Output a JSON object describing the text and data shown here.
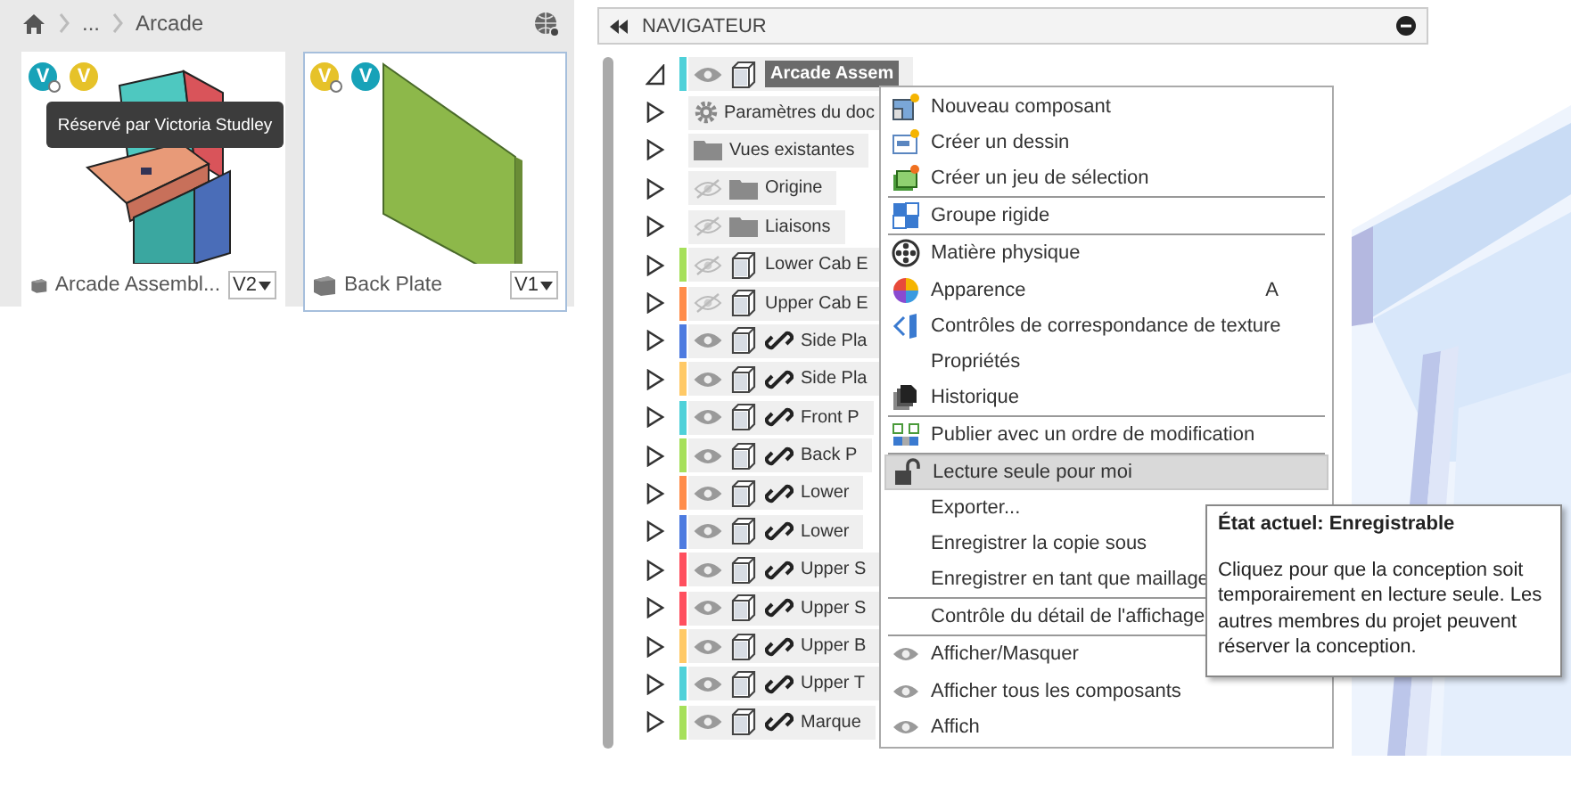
{
  "breadcrumb": [
    "...",
    "Arcade"
  ],
  "cards": [
    {
      "name": "Arcade Assembl...",
      "version": "V2",
      "selected": false,
      "tooltip": "Réservé par Victoria Studley",
      "badges": [
        {
          "letter": "V",
          "color": "#17a2b8",
          "dot": true
        },
        {
          "letter": "V",
          "color": "#e6c229",
          "dot": false
        }
      ]
    },
    {
      "name": "Back Plate",
      "version": "V1",
      "selected": true,
      "badges": [
        {
          "letter": "V",
          "color": "#e6c229",
          "dot": true
        },
        {
          "letter": "V",
          "color": "#17a2b8",
          "dot": false
        }
      ]
    }
  ],
  "navigator": {
    "title": "NAVIGATEUR",
    "rows": [
      {
        "label": "Arcade Assem",
        "kind": "root",
        "expanded": true,
        "color": "#4fd1d9",
        "visible": true
      },
      {
        "label": "Paramètres du doc",
        "kind": "settings",
        "expanded": false
      },
      {
        "label": "Vues existantes",
        "kind": "folder",
        "expanded": false
      },
      {
        "label": "Origine",
        "kind": "folder",
        "expanded": false,
        "visible": false
      },
      {
        "label": "Liaisons",
        "kind": "folder",
        "expanded": false,
        "visible": false
      },
      {
        "label": "Lower Cab E",
        "kind": "component",
        "expanded": false,
        "color": "#a6e05a",
        "visible": false
      },
      {
        "label": "Upper Cab E",
        "kind": "component",
        "expanded": false,
        "color": "#ff8c4a",
        "visible": false
      },
      {
        "label": "Side Pla",
        "kind": "linked",
        "expanded": false,
        "color": "#4d7be0",
        "visible": true
      },
      {
        "label": "Side Pla",
        "kind": "linked",
        "expanded": false,
        "color": "#ffc966",
        "visible": true
      },
      {
        "label": "Front P",
        "kind": "linked",
        "expanded": false,
        "color": "#4fd1d9",
        "visible": true
      },
      {
        "label": "Back P",
        "kind": "linked",
        "expanded": false,
        "color": "#a6e05a",
        "visible": true
      },
      {
        "label": "Lower",
        "kind": "linked",
        "expanded": false,
        "color": "#ff8c4a",
        "visible": true
      },
      {
        "label": "Lower",
        "kind": "linked",
        "expanded": false,
        "color": "#4d7be0",
        "visible": true
      },
      {
        "label": "Upper S",
        "kind": "linked",
        "expanded": false,
        "color": "#ff4f5e",
        "visible": true
      },
      {
        "label": "Upper S",
        "kind": "linked",
        "expanded": false,
        "color": "#ff4f5e",
        "visible": true
      },
      {
        "label": "Upper B",
        "kind": "linked",
        "expanded": false,
        "color": "#ffc966",
        "visible": true
      },
      {
        "label": "Upper T",
        "kind": "linked",
        "expanded": false,
        "color": "#4fd1d9",
        "visible": true
      },
      {
        "label": "Marque",
        "kind": "linked",
        "expanded": false,
        "color": "#a6e05a",
        "visible": true
      }
    ]
  },
  "context_menu": {
    "groups": [
      [
        {
          "label": "Nouveau composant",
          "kind": "new-component",
          "selected": false
        },
        {
          "label": "Créer un dessin",
          "kind": "drawing",
          "selected": false
        },
        {
          "label": "Créer un jeu de sélection",
          "kind": "selection-set",
          "selected": false
        }
      ],
      [
        {
          "label": "Groupe rigide",
          "kind": "rigid-group",
          "selected": false
        }
      ],
      [
        {
          "label": "Matière physique",
          "kind": "material",
          "selected": false
        },
        {
          "label": "Apparence",
          "kind": "appearance",
          "shortcut": "A",
          "selected": false
        },
        {
          "label": "Contrôles de correspondance de texture",
          "kind": "texture",
          "selected": false
        },
        {
          "label": "Propriétés",
          "kind": "plain",
          "selected": false
        },
        {
          "label": "Historique",
          "kind": "history",
          "selected": false
        }
      ],
      [
        {
          "label": "Publier avec un ordre de modification",
          "kind": "publish",
          "selected": false
        }
      ],
      [
        {
          "label": "Lecture seule pour moi",
          "kind": "lock",
          "selected": true
        },
        {
          "label": "Exporter...",
          "kind": "plain",
          "selected": false
        },
        {
          "label": "Enregistrer la copie sous",
          "kind": "plain",
          "selected": false
        },
        {
          "label": "Enregistrer en tant que maillage",
          "kind": "plain",
          "selected": false
        }
      ],
      [
        {
          "label": "Contrôle du détail de l'affichage",
          "kind": "plain",
          "selected": false
        }
      ],
      [
        {
          "label": "Afficher/Masquer",
          "kind": "eye",
          "selected": false
        },
        {
          "label": "Afficher tous les composants",
          "kind": "eye",
          "selected": false
        },
        {
          "label": "Affich",
          "kind": "eye",
          "selected": false
        }
      ]
    ]
  },
  "tooltip": {
    "title": "État actuel: Enregistrable",
    "body": "Cliquez pour que la conception soit temporairement en lecture seule. Les autres membres du projet peuvent réserver la conception."
  }
}
